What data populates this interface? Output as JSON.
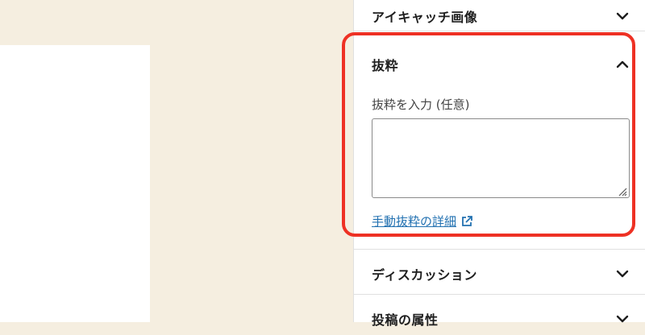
{
  "sidebar": {
    "featured_image": {
      "title": "アイキャッチ画像"
    },
    "excerpt": {
      "title": "抜粋",
      "field_label": "抜粋を入力 (任意)",
      "value": "",
      "link_text": "手動抜粋の詳細"
    },
    "discussion": {
      "title": "ディスカッション"
    },
    "attributes": {
      "title": "投稿の属性"
    }
  },
  "icons": {
    "collapsed": "chevron-down-icon",
    "expanded": "chevron-up-icon",
    "external": "external-link-icon",
    "resize": "resize-handle-icon"
  },
  "colors": {
    "link": "#2271b1",
    "highlight": "#ee3124",
    "background": "#f5eee0"
  }
}
